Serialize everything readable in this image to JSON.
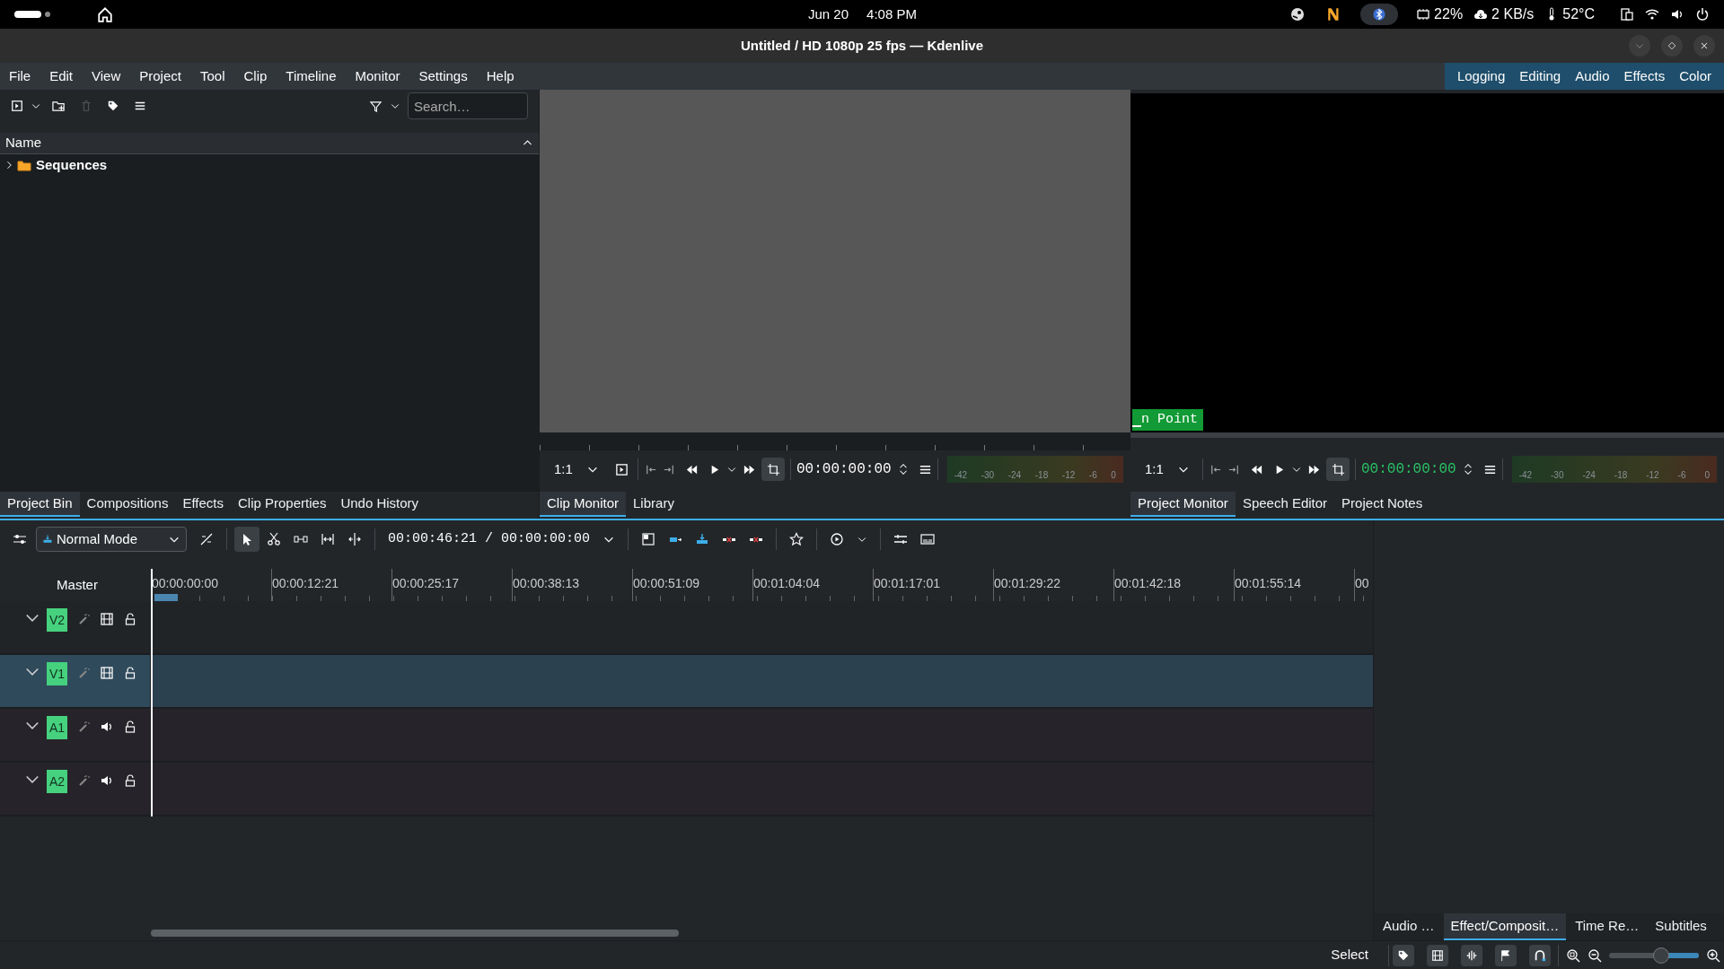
{
  "system_bar": {
    "date": "Jun 20",
    "time": "4:08 PM",
    "cpu": "22%",
    "network": "2 KB/s",
    "temperature": "52°C"
  },
  "window": {
    "title": "Untitled / HD 1080p 25 fps — Kdenlive"
  },
  "menu": [
    "File",
    "Edit",
    "View",
    "Project",
    "Tool",
    "Clip",
    "Timeline",
    "Monitor",
    "Settings",
    "Help"
  ],
  "layouts": [
    "Logging",
    "Editing",
    "Audio",
    "Effects",
    "Color"
  ],
  "project_bin": {
    "search": {
      "placeholder": "Search…"
    },
    "column": "Name",
    "items": [
      {
        "label": "Sequences",
        "expanded": false
      }
    ]
  },
  "left_tabs": [
    {
      "label": "Project Bin",
      "selected": true
    },
    {
      "label": "Compositions",
      "selected": false
    },
    {
      "label": "Effects",
      "selected": false
    },
    {
      "label": "Clip Properties",
      "selected": false
    },
    {
      "label": "Undo History",
      "selected": false
    }
  ],
  "clip_monitor": {
    "zoom": "1:1",
    "timecode": "00:00:00:00",
    "meter_labels": [
      "-42",
      "-30",
      "-24",
      "-18",
      "-12",
      "-6",
      "0"
    ]
  },
  "clip_tabs": [
    {
      "label": "Clip Monitor",
      "selected": true
    },
    {
      "label": "Library",
      "selected": false
    }
  ],
  "project_monitor": {
    "overlay": "n Point",
    "zoom": "1:1",
    "timecode": "00:00:00:00",
    "meter_labels": [
      "-42",
      "-30",
      "-24",
      "-18",
      "-12",
      "-6",
      "0"
    ]
  },
  "project_tabs": [
    {
      "label": "Project Monitor",
      "selected": true
    },
    {
      "label": "Speech Editor",
      "selected": false
    },
    {
      "label": "Project Notes",
      "selected": false
    }
  ],
  "timeline": {
    "mode": "Normal Mode",
    "timecode": "00:00:46:21 / 00:00:00:00",
    "master": "Master",
    "ruler": [
      "00:00:00:00",
      "00:00:12:21",
      "00:00:25:17",
      "00:00:38:13",
      "00:00:51:09",
      "00:01:04:04",
      "00:01:17:01",
      "00:01:29:22",
      "00:01:42:18",
      "00:01:55:14",
      "00"
    ],
    "tracks": [
      {
        "name": "V2",
        "kind": "video",
        "selected": false
      },
      {
        "name": "V1",
        "kind": "video",
        "selected": true
      },
      {
        "name": "A1",
        "kind": "audio",
        "selected": false
      },
      {
        "name": "A2",
        "kind": "audio",
        "selected": false
      }
    ]
  },
  "side_tabs": [
    {
      "label": "Audio …",
      "selected": false
    },
    {
      "label": "Effect/Composit…",
      "selected": true
    },
    {
      "label": "Time Re…",
      "selected": false
    },
    {
      "label": "Subtitles",
      "selected": false
    }
  ],
  "status_bar": {
    "tool": "Select",
    "zoom": {
      "level": 0.58
    }
  }
}
